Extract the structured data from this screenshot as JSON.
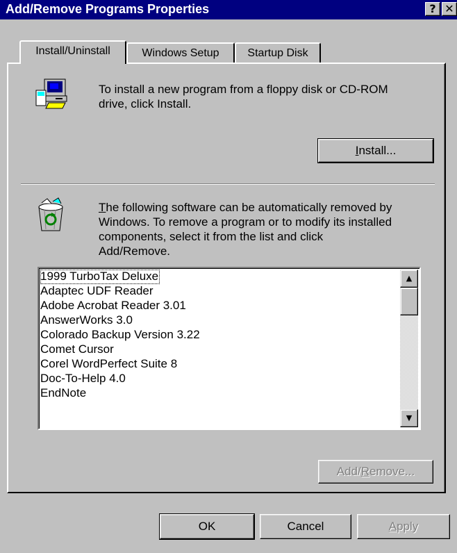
{
  "window": {
    "title": "Add/Remove Programs Properties",
    "help_label": "?",
    "close_label": "✕"
  },
  "tabs": [
    {
      "label": "Install/Uninstall",
      "active": true
    },
    {
      "label": "Windows Setup",
      "active": false
    },
    {
      "label": "Startup Disk",
      "active": false
    }
  ],
  "install_section": {
    "icon": "computer-disk-icon",
    "text": "To install a new program from a floppy disk or CD-ROM drive, click Install.",
    "text_line1": "To install a new program from a floppy disk or CD-ROM",
    "text_line2": "drive, click Install.",
    "button_label_pre": "",
    "button_mnemonic": "I",
    "button_label_post": "nstall..."
  },
  "remove_section": {
    "icon": "recycle-bin-icon",
    "text_line1_mnemonic": "T",
    "text_line1_rest": "he following software can be automatically removed by",
    "text_line2": "Windows. To remove a program or to modify its installed",
    "text_line3": "components, select it from the list and click",
    "text_line4": "Add/Remove."
  },
  "programs": [
    "1999 TurboTax Deluxe",
    "Adaptec UDF Reader",
    "Adobe Acrobat Reader 3.01",
    "AnswerWorks 3.0",
    "Colorado Backup Version 3.22",
    "Comet Cursor",
    "Corel WordPerfect Suite 8",
    "Doc-To-Help 4.0",
    "EndNote"
  ],
  "add_remove_button": {
    "pre": "Add/",
    "mnemonic": "R",
    "post": "emove..."
  },
  "footer": {
    "ok_label": "OK",
    "cancel_label": "Cancel",
    "apply_mnemonic": "A",
    "apply_rest": "pply"
  },
  "scrollbar": {
    "up_icon": "scroll-up-arrow-icon",
    "down_icon": "scroll-down-arrow-icon",
    "up_glyph": "▲",
    "down_glyph": "▼"
  }
}
